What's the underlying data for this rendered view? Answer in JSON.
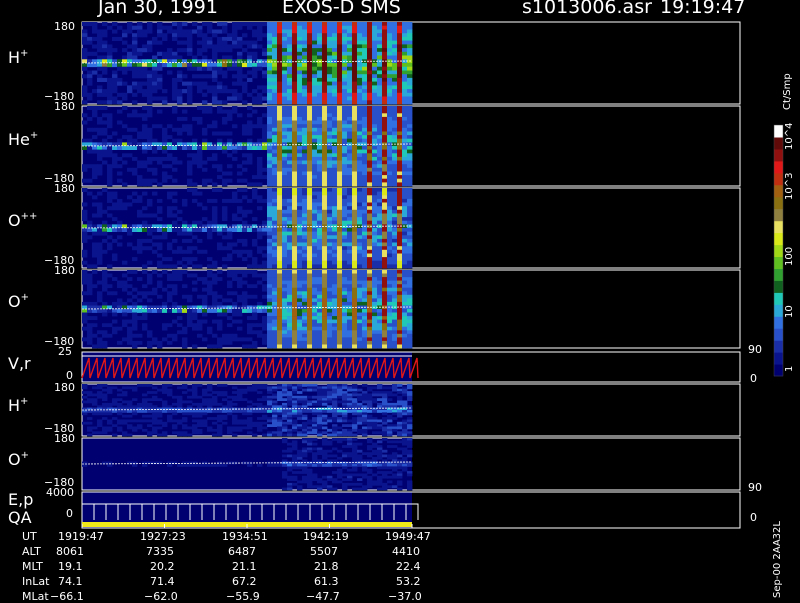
{
  "header": {
    "date": "Jan 30, 1991",
    "instrument": "EXOS-D SMS",
    "file": "s1013006.asr",
    "time": "19:19:47"
  },
  "colorbar": {
    "unit": "Ct/Smp",
    "ticks": [
      "1",
      "10",
      "100",
      "10^3",
      "10^4"
    ],
    "colors": [
      "#000070",
      "#0a148c",
      "#1a2ea8",
      "#2850c8",
      "#3070e0",
      "#2aa8d8",
      "#20c8b8",
      "#106020",
      "#30a030",
      "#60c020",
      "#a0d818",
      "#d8e818",
      "#e8e060",
      "#908040",
      "#8a7010",
      "#a06010",
      "#c03010",
      "#e01818",
      "#901010",
      "#600a0a",
      "#ffffff"
    ]
  },
  "panels": [
    {
      "id": "h-plus",
      "species": "H",
      "charge": "+",
      "ytop": "180",
      "ybot": "−180",
      "intensity": 1.4
    },
    {
      "id": "he-plus",
      "species": "He",
      "charge": "+",
      "ytop": "180",
      "ybot": "−180",
      "intensity": 1.0
    },
    {
      "id": "o-plusplus",
      "species": "O",
      "charge": "++",
      "ytop": "180",
      "ybot": "−180",
      "intensity": 0.95
    },
    {
      "id": "o-plus",
      "species": "O",
      "charge": "+",
      "ytop": "180",
      "ybot": "−180",
      "intensity": 1.05
    },
    {
      "id": "vr",
      "label": "V,r",
      "ytop": "25",
      "ybot": "0",
      "right_top": "90",
      "right_bot": "0"
    },
    {
      "id": "h-plus-2",
      "species": "H",
      "charge": "+",
      "ytop": "180",
      "ybot": "−180",
      "intensity": 0.55
    },
    {
      "id": "o-plus-2",
      "species": "O",
      "charge": "+",
      "ytop": "180",
      "ybot": "−180",
      "intensity": 0.3
    },
    {
      "id": "ep-qa",
      "label": "E,p",
      "label2": "QA",
      "ytop": "4000",
      "ybot": "0",
      "right_top": "90",
      "right_bot": "0"
    }
  ],
  "footer": {
    "rows": [
      {
        "name": "UT",
        "values": [
          "1919:47",
          "1927:23",
          "1934:51",
          "1942:19",
          "1949:47"
        ]
      },
      {
        "name": "ALT",
        "values": [
          "8061",
          "7335",
          "6487",
          "5507",
          "4410"
        ]
      },
      {
        "name": "MLT",
        "values": [
          "19.1",
          "20.2",
          "21.1",
          "21.8",
          "22.4"
        ]
      },
      {
        "name": "InLat",
        "values": [
          "74.1",
          "71.4",
          "67.2",
          "61.3",
          "53.2"
        ]
      },
      {
        "name": "MLat",
        "values": [
          "−66.1",
          "−62.0",
          "−55.9",
          "−47.7",
          "−37.0"
        ]
      }
    ]
  },
  "side_code": "Sep-00 2AA32L",
  "chart_data": {
    "type": "heatmap",
    "title": "Jan 30, 1991 EXOS-D SMS",
    "xlabel": "UT",
    "x_ticks": [
      "1919:47",
      "1927:23",
      "1934:51",
      "1942:19",
      "1949:47"
    ],
    "panels": [
      "H+",
      "He+",
      "O++",
      "O+",
      "V,r",
      "H+",
      "O+",
      "E,p QA"
    ],
    "ylim_angle": [
      -180,
      180
    ],
    "colorscale_unit": "Ct/Smp",
    "colorscale_ticks": [
      1,
      10,
      100,
      1000,
      10000
    ],
    "colorscale_type": "log"
  }
}
